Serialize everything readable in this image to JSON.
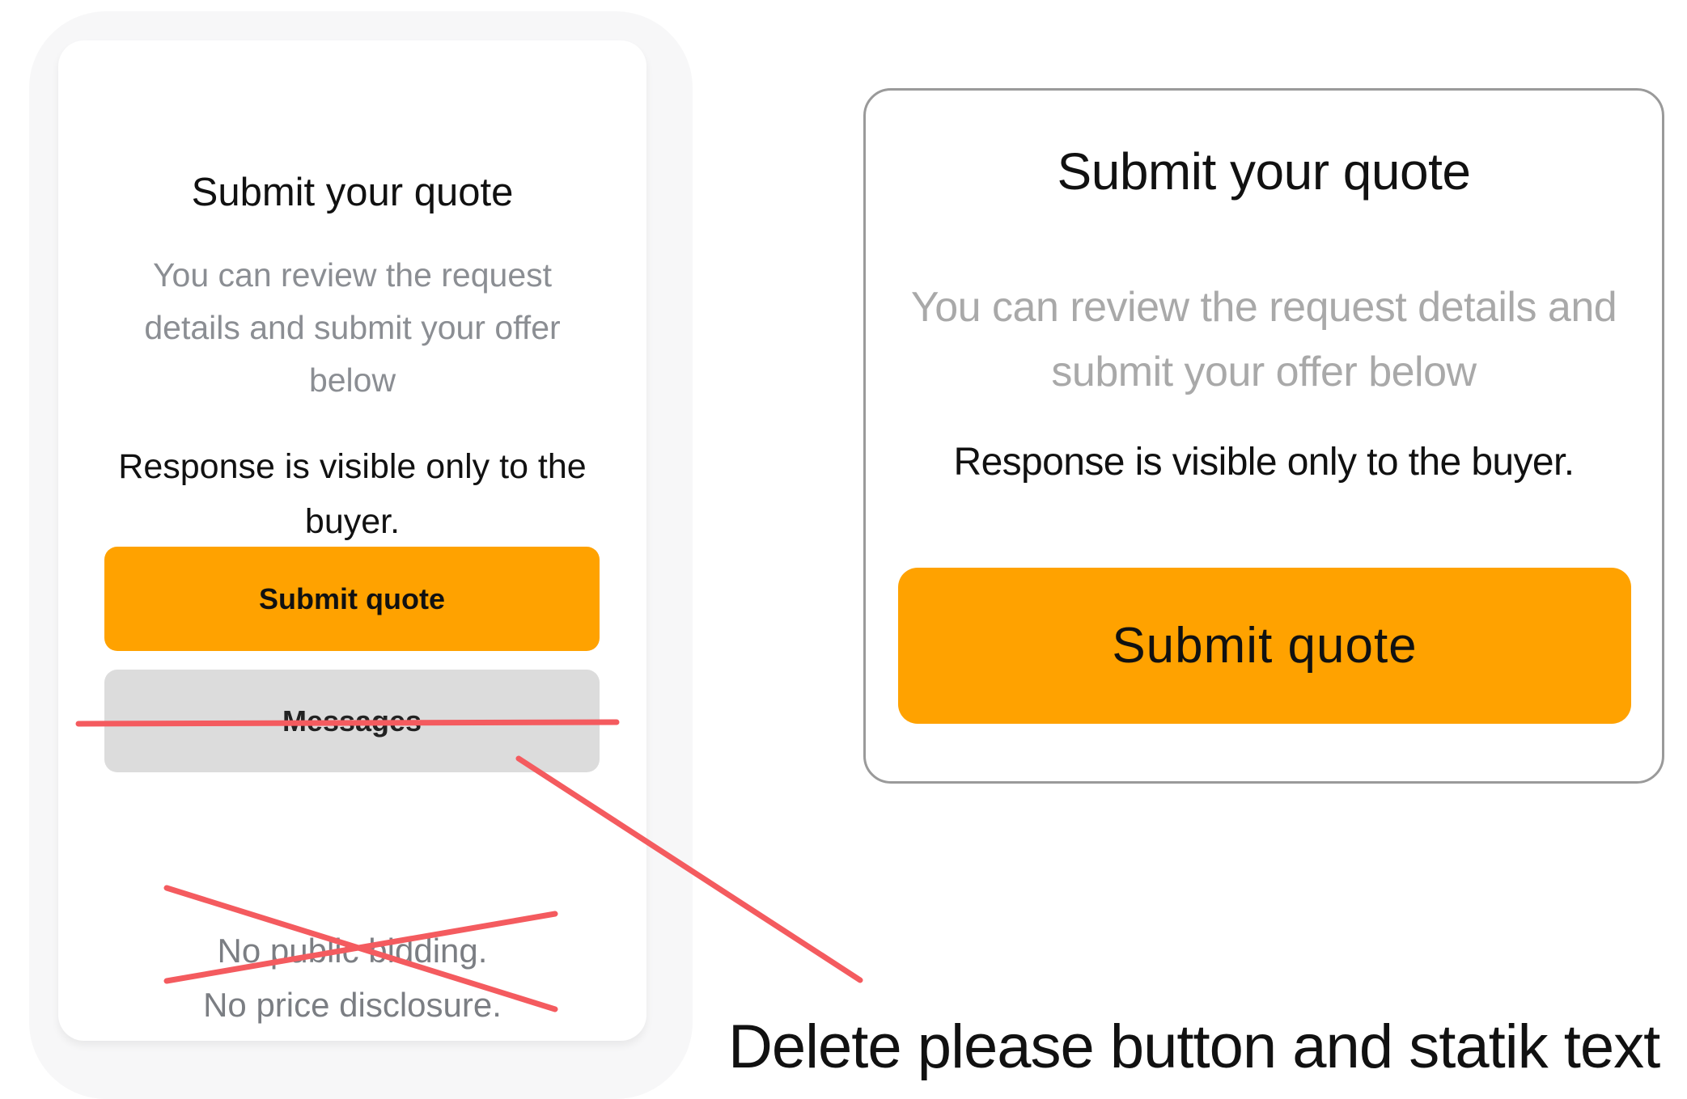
{
  "original_card": {
    "title": "Submit your quote",
    "description": "You can review the request details and submit your offer below",
    "visibility_note": "Response is visible only to the buyer.",
    "submit_button_label": "Submit quote",
    "messages_button_label": "Messages",
    "static_text_line1": "No public bidding.",
    "static_text_line2": "No price disclosure."
  },
  "redesigned_card": {
    "title": "Submit your quote",
    "description": "You can review the request details and submit your offer below",
    "visibility_note": "Response is visible only to the buyer.",
    "submit_button_label": "Submit quote"
  },
  "annotation": {
    "note": "Delete please button and statik text",
    "strike_color": "#f45b5f"
  },
  "colors": {
    "accent_orange": "#ffa200",
    "secondary_gray": "#dcdcdc",
    "muted_text": "#8b8e93"
  }
}
